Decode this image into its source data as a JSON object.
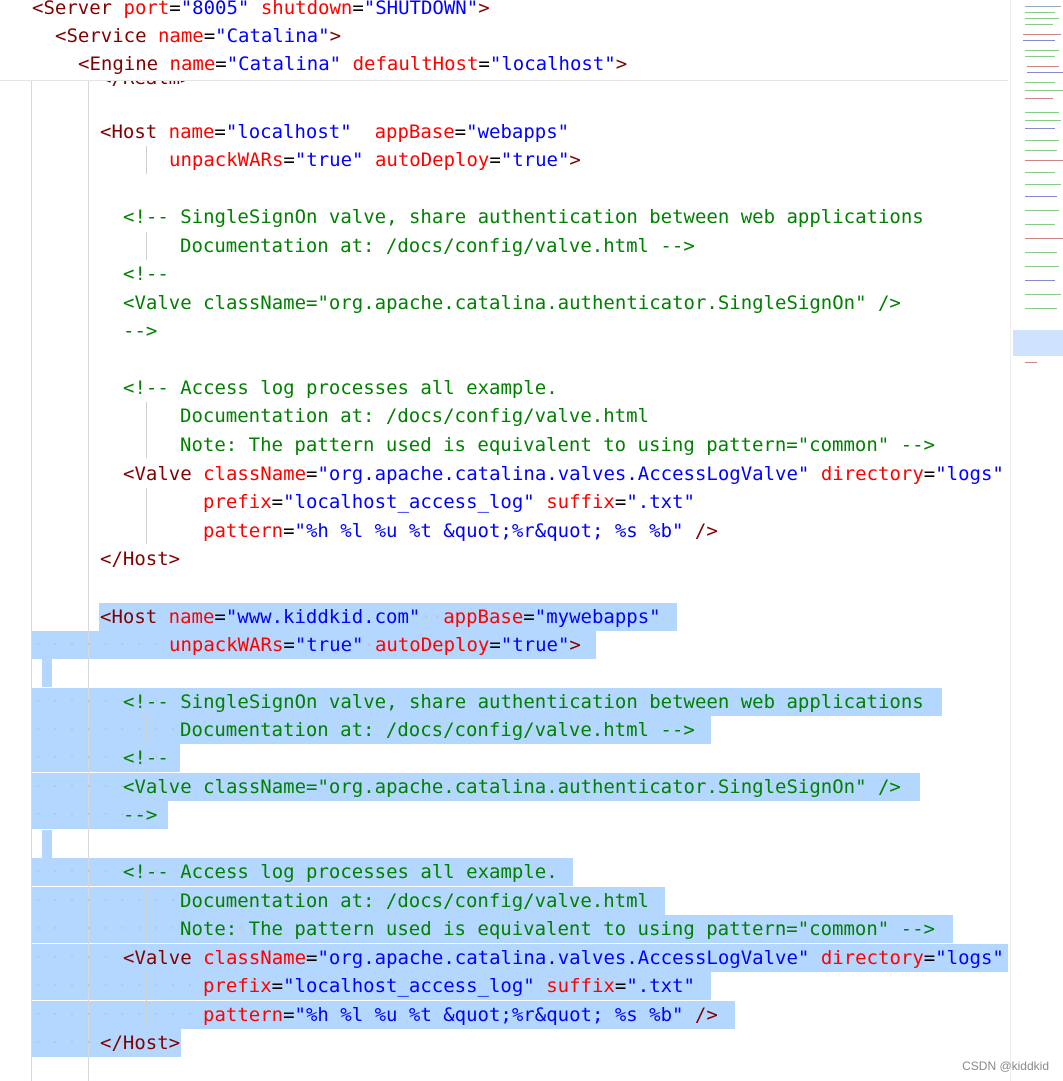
{
  "editor": {
    "sticky": [
      {
        "t1": "<Server ",
        "a1": "port",
        "v1": "\"8005\"",
        "a2": "shutdown",
        "v2": "\"SHUTDOWN\"",
        "t2": ">"
      },
      {
        "t1": "<Service ",
        "a1": "name",
        "v1": "\"Catalina\"",
        "t2": ">"
      },
      {
        "t1": "<Engine ",
        "a1": "name",
        "v1": "\"Catalina\"",
        "a2": "defaultHost",
        "v2": "\"localhost\"",
        "t2": ">"
      }
    ],
    "partial_line": "</Realm>",
    "host1": {
      "open_tag": "<Host ",
      "name_attr": "name",
      "name_val": "\"localhost\"",
      "appbase_attr": "appBase",
      "appbase_val": "\"webapps\"",
      "unpack_attr": "unpackWARs",
      "unpack_val": "\"true\"",
      "deploy_attr": "autoDeploy",
      "deploy_val": "\"true\"",
      "close_bracket": ">",
      "close_tag": "</Host>"
    },
    "host2": {
      "open_tag": "<Host ",
      "name_attr": "name",
      "name_val": "\"www.kiddkid.com\"",
      "appbase_attr": "appBase",
      "appbase_val": "\"mywebapps\"",
      "unpack_attr": "unpackWARs",
      "unpack_val": "\"true\"",
      "deploy_attr": "autoDeploy",
      "deploy_val": "\"true\"",
      "close_bracket": ">",
      "close_tag": "</Host>"
    },
    "sso_comment_1": "<!-- SingleSignOn valve, share authentication between web applications",
    "sso_comment_2": "Documentation at: /docs/config/valve.html -->",
    "comment_open": "<!--",
    "sso_valve": "<Valve className=\"org.apache.catalina.authenticator.SingleSignOn\" />",
    "comment_close": "-->",
    "log_comment_1": "<!-- Access log processes all example.",
    "log_comment_2": "Documentation at: /docs/config/valve.html",
    "log_comment_3": "Note: The pattern used is equivalent to using pattern=\"common\" -->",
    "valve_tag": "<Valve ",
    "classname_attr": "className",
    "classname_val": "\"org.apache.catalina.valves.AccessLogValve\"",
    "directory_attr": "directory",
    "directory_val": "\"logs\"",
    "prefix_attr": "prefix",
    "prefix_val": "\"localhost_access_log\"",
    "suffix_attr": "suffix",
    "suffix_val": "\".txt\"",
    "pattern_attr": "pattern",
    "pattern_val": "\"%h %l %u %t &quot;%r&quot; %s %b\"",
    "selfclose": " />",
    "eq": "="
  },
  "watermark": "CSDN @kiddkid",
  "colors": {
    "tag": "#800000",
    "attribute": "#ff0000",
    "value": "#0000ff",
    "comment": "#008000",
    "selection": "#b3d7ff"
  }
}
